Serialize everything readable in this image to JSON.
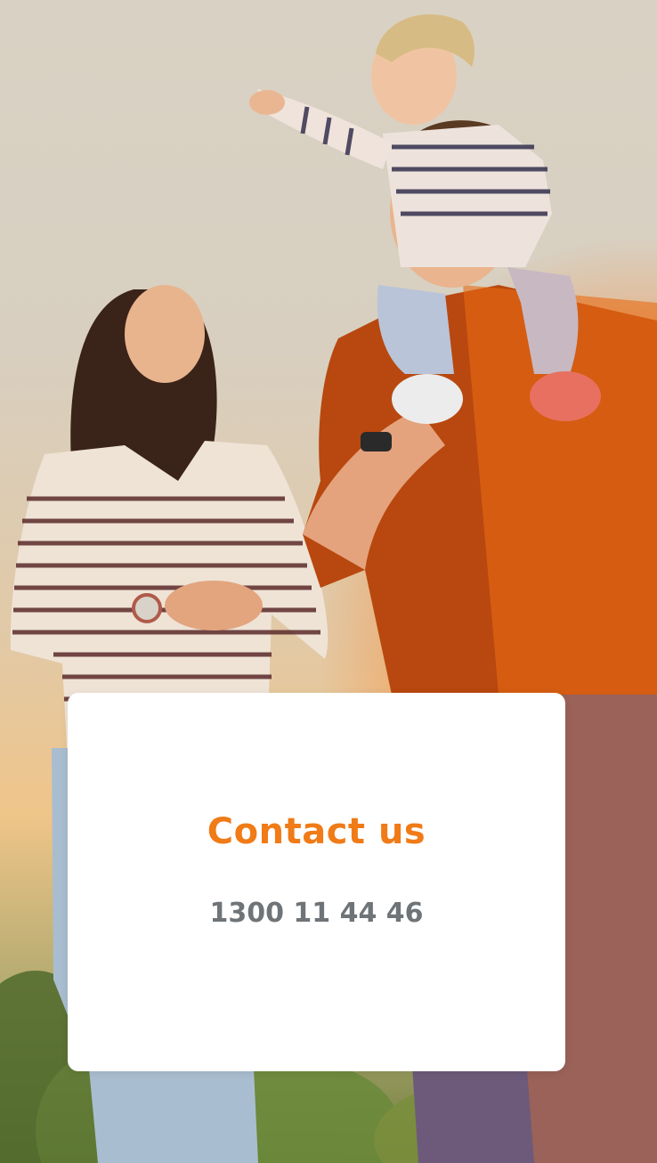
{
  "hero": {
    "image": "family-photo"
  },
  "contact_card": {
    "title": "Contact us",
    "phone": "1300 11 44 46"
  },
  "colors": {
    "accent": "#f07b17",
    "phone_text": "#6f7478",
    "card_bg": "#ffffff"
  }
}
